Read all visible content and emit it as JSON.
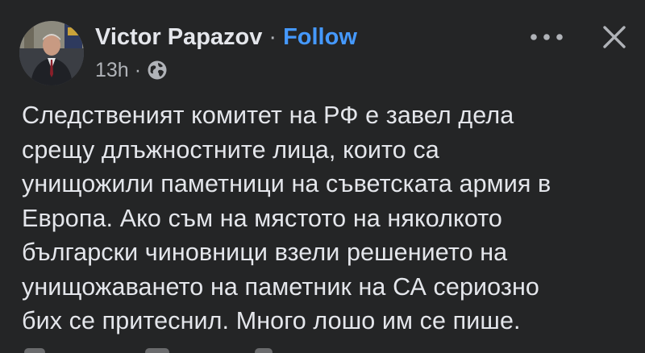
{
  "author": {
    "name": "Victor Papazov",
    "separator": "·",
    "follow_label": "Follow"
  },
  "meta": {
    "timestamp": "13h",
    "separator": "·",
    "audience_icon": "globe-icon"
  },
  "actions": {
    "more_icon": "more-horizontal-icon",
    "close_icon": "close-icon"
  },
  "post": {
    "text": "Следственият комитет на РФ е завел дела\nсрещу длъжностните лица, които са\nунищожили паметници на съветската армия в\nЕвропа. Ако съм на мястото на няколкото\nбългарски чиновници взели решението на\nунищожаването на паметник на СА сериозно\nбих се притеснил. Много лошо им се пише."
  },
  "colors": {
    "background": "#242526",
    "text_primary": "#e4e6eb",
    "text_secondary": "#b0b3b8",
    "link": "#4599ff"
  }
}
